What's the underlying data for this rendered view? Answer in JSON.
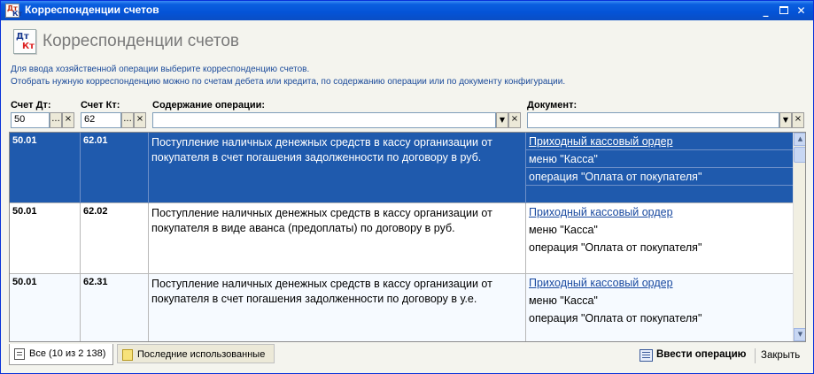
{
  "window": {
    "title": "Корреспонденции счетов",
    "icon_text_top": "Дт",
    "icon_text_bottom": "Кт"
  },
  "header": {
    "title": "Корреспонденции счетов",
    "hint_line1": "Для ввода хозяйственной операции выберите корреспонденцию счетов.",
    "hint_line2": "Отобрать нужную корреспонденцию можно по счетам дебета или кредита, по содержанию операции или по документу конфигурации."
  },
  "filters": {
    "debit_label": "Счет Дт:",
    "debit_value": "50",
    "credit_label": "Счет Кт:",
    "credit_value": "62",
    "operation_label": "Содержание операции:",
    "operation_value": "",
    "document_label": "Документ:",
    "document_value": "",
    "select_button": "...",
    "clear_button": "×",
    "dropdown_glyph": "▼"
  },
  "rows": [
    {
      "debit": "50.01",
      "credit": "62.01",
      "operation": "Поступление наличных денежных средств в кассу организации от покупателя в счет погашения задолженности по договору в руб.",
      "doc_link": "Приходный кассовый ордер",
      "doc_menu": "меню \"Касса\"",
      "doc_operation": "операция \"Оплата от покупателя\"",
      "selected": true
    },
    {
      "debit": "50.01",
      "credit": "62.02",
      "operation": "Поступление наличных денежных средств в кассу организации от покупателя в виде аванса (предоплаты) по договору в руб.",
      "doc_link": "Приходный кассовый ордер",
      "doc_menu": "меню \"Касса\"",
      "doc_operation": "операция \"Оплата от покупателя\"",
      "selected": false
    },
    {
      "debit": "50.01",
      "credit": "62.31",
      "operation": "Поступление наличных денежных средств в кассу организации от покупателя в счет погашения задолженности по договору в у.е.",
      "doc_link": "Приходный кассовый ордер",
      "doc_menu": "меню \"Касса\"",
      "doc_operation": "операция \"Оплата от покупателя\"",
      "selected": false
    }
  ],
  "tabs": {
    "all": "Все (10 из 2 138)",
    "recent": "Последние использованные"
  },
  "footer": {
    "enter_operation": "Ввести операцию",
    "close": "Закрыть"
  },
  "colors": {
    "selection": "#1f5aad",
    "link": "#1a4aa0",
    "title_bar": "#0453d6"
  }
}
